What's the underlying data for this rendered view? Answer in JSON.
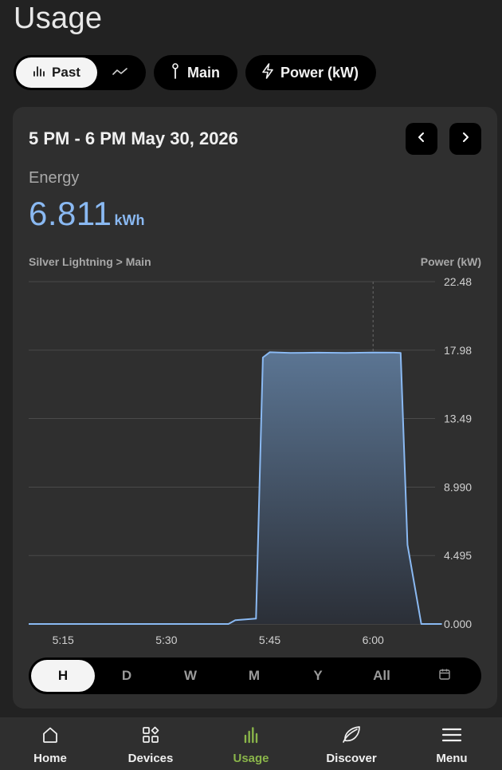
{
  "page": {
    "title": "Usage"
  },
  "toolbar": {
    "view_toggle": {
      "active_label": "Past",
      "active_icon": "bar-chart-icon",
      "inactive_icon": "trend-line-icon"
    },
    "device_button": {
      "label": "Main",
      "icon": "clamp-sensor-icon"
    },
    "metric_button": {
      "label": "Power (kW)",
      "icon": "lightning-bolt-icon"
    }
  },
  "card": {
    "range_title": "5 PM - 6 PM May 30, 2026",
    "energy": {
      "label": "Energy",
      "value": "6.811",
      "unit": "kWh"
    },
    "chart_source": "Silver Lightning > Main",
    "chart_unit": "Power (kW)"
  },
  "chart_data": {
    "type": "area",
    "title": "",
    "xlabel": "",
    "ylabel": "Power (kW)",
    "x_tick_labels": [
      "5:15",
      "5:30",
      "5:45",
      "6:00"
    ],
    "x_tick_minutes": [
      15,
      30,
      45,
      60
    ],
    "y_tick_labels": [
      "22.48",
      "17.98",
      "13.49",
      "8.990",
      "4.495",
      "0.000"
    ],
    "y_tick_values": [
      22.48,
      17.98,
      13.49,
      8.99,
      4.495,
      0.0
    ],
    "xlim_minutes": [
      10,
      69
    ],
    "ylim": [
      0,
      22.48
    ],
    "grid": true,
    "y_axis_side": "right",
    "cursor_minute": 60,
    "series": [
      {
        "color": "#8ab9f2",
        "x_minutes": [
          10,
          39,
          40,
          43,
          44,
          45,
          48,
          52,
          56,
          60,
          63,
          64,
          65,
          67,
          70
        ],
        "values": [
          0.0,
          0.0,
          0.25,
          0.35,
          17.5,
          17.85,
          17.8,
          17.82,
          17.8,
          17.83,
          17.82,
          17.8,
          5.2,
          0.0,
          0.0
        ]
      }
    ]
  },
  "periods": {
    "items": [
      "H",
      "D",
      "W",
      "M",
      "Y",
      "All"
    ],
    "active": "H",
    "calendar_icon": "calendar-icon"
  },
  "bottom_nav": {
    "items": [
      {
        "label": "Home",
        "icon": "home-icon"
      },
      {
        "label": "Devices",
        "icon": "devices-grid-icon"
      },
      {
        "label": "Usage",
        "icon": "usage-bars-icon"
      },
      {
        "label": "Discover",
        "icon": "leaf-icon"
      },
      {
        "label": "Menu",
        "icon": "hamburger-menu-icon"
      }
    ],
    "active": "Usage",
    "active_color": "#8ab54a"
  }
}
